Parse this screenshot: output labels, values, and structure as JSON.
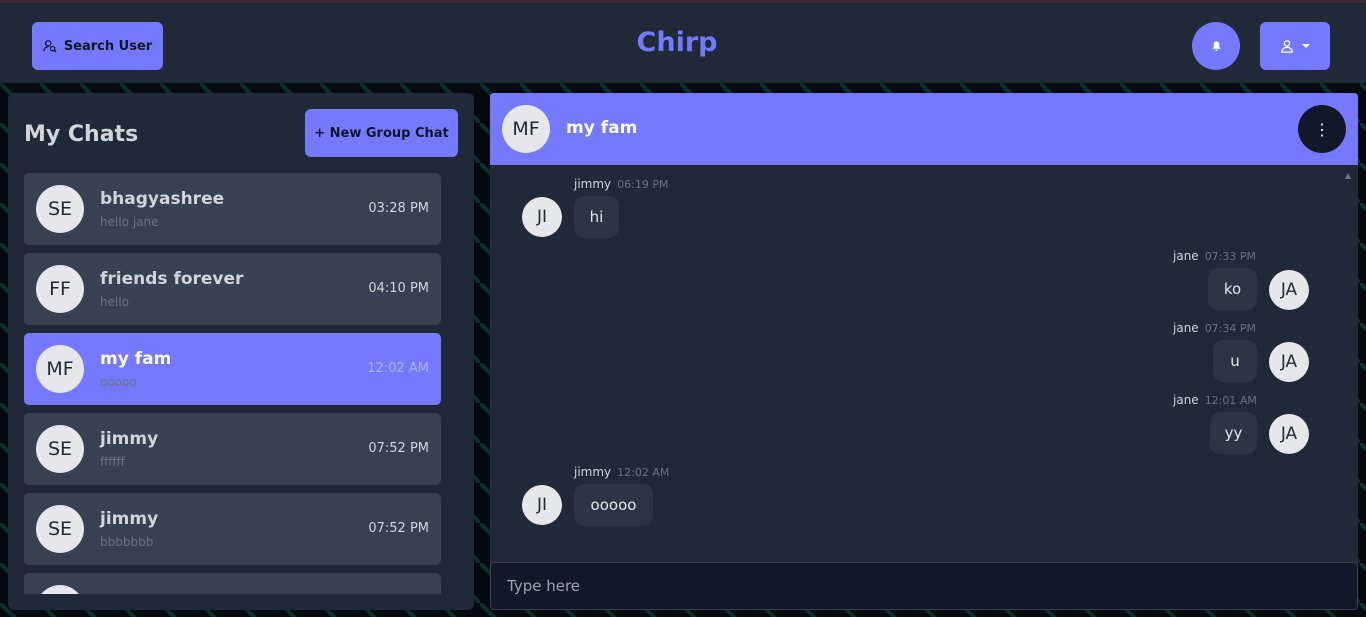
{
  "header": {
    "search_label": "Search User",
    "brand": "Chirp",
    "accent_color": "#7479ff"
  },
  "sidebar": {
    "title": "My Chats",
    "new_group_label": "+ New Group Chat",
    "chats": [
      {
        "initials": "SE",
        "name": "bhagyashree",
        "preview": "hello jane",
        "time": "03:28 PM"
      },
      {
        "initials": "FF",
        "name": "friends forever",
        "preview": "hello",
        "time": "04:10 PM"
      },
      {
        "initials": "MF",
        "name": "my fam",
        "preview": "ooooo",
        "time": "12:02 AM",
        "active": true
      },
      {
        "initials": "SE",
        "name": "jimmy",
        "preview": "ffffff",
        "time": "07:52 PM"
      },
      {
        "initials": "SE",
        "name": "jimmy",
        "preview": "bbbbbbb",
        "time": "07:52 PM"
      }
    ]
  },
  "conversation": {
    "initials": "MF",
    "title": "my fam",
    "messages": [
      {
        "sender": "jimmy",
        "time": "06:19 PM",
        "text": "hi",
        "initials": "JI"
      },
      {
        "sender": "jane",
        "time": "07:33 PM",
        "text": "ko",
        "initials": "JA"
      },
      {
        "sender": "jane",
        "time": "07:34 PM",
        "text": "u",
        "initials": "JA"
      },
      {
        "sender": "jane",
        "time": "12:01 AM",
        "text": "yy",
        "initials": "JA"
      },
      {
        "sender": "jimmy",
        "time": "12:02 AM",
        "text": "ooooo",
        "initials": "JI"
      }
    ],
    "input_placeholder": "Type here"
  }
}
